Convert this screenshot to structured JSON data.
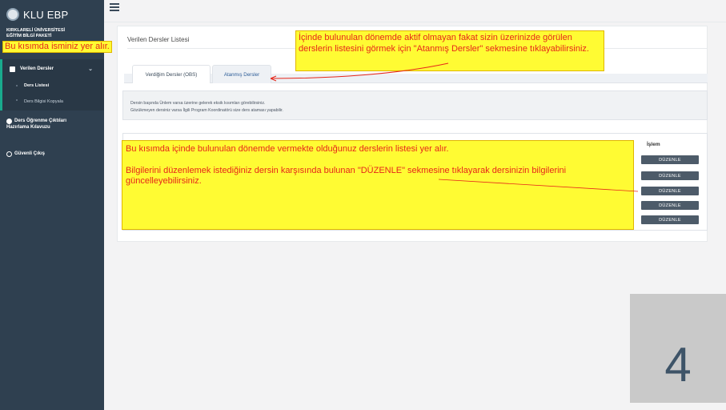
{
  "sidebar": {
    "brand": "KLU EBP",
    "university_lines": [
      "KIRKLARELİ ÜNİVERSİTESİ",
      "EĞİTİM BİLGİ PAKETİ"
    ],
    "main_item": "Verilen Dersler",
    "sub_items": [
      "Ders Listesi",
      "Ders Bilgisi Kopyala"
    ],
    "guide_item": [
      "Ders Öğrenme Çıktıları",
      "Hazırlama Kılavuzu"
    ],
    "logout_item": "Güvenli Çıkış"
  },
  "page": {
    "title": "Verilen Dersler Listesi",
    "tabs": [
      "Verdiğim Dersler (OBS)",
      "Atanmış Dersler"
    ],
    "info_lines": [
      "Dersin başında Ünlem varsa üzerine gelerek eksik kısımları görebilirsiniz.",
      "Gözükmeyen dersiniz varsa İlgili Program Koordinatörü size ders ataması yapabilir."
    ],
    "column_header": "İşlem",
    "edit_buttons": [
      "DÜZENLE",
      "DÜZENLE",
      "DÜZENLE",
      "DÜZENLE",
      "DÜZENLE"
    ]
  },
  "annotations": {
    "name_note": "Bu kısımda isminiz yer alır.",
    "tab_note": "İçinde bulunulan dönemde aktif olmayan fakat sizin üzerinizde görülen derslerin listesini görmek için \"Atanmış Dersler\" sekmesine tıklayabilirsiniz.",
    "list_note_line1": "Bu kısımda içinde bulunulan dönemde vermekte olduğunuz derslerin listesi yer alır.",
    "list_note_line2": "Bilgilerini düzenlemek istediğiniz dersin karşısında bulunan \"DÜZENLE\" sekmesine tıklayarak dersinizin bilgilerini güncelleyebilirsiniz."
  },
  "step_number": "4",
  "colors": {
    "sidebar": "#2f4050",
    "accent": "#19aa8d",
    "note_bg": "#fffb33",
    "note_text": "#e6271a",
    "button": "#4d5b69"
  }
}
